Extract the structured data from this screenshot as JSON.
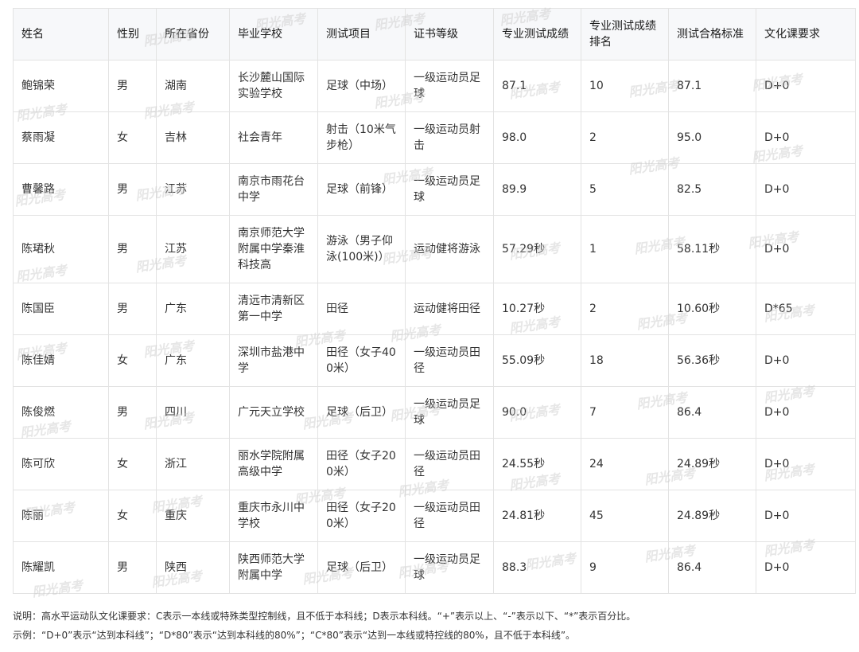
{
  "headers": [
    "姓名",
    "性别",
    "所在省份",
    "毕业学校",
    "测试项目",
    "证书等级",
    "专业测试成绩",
    "专业测试成绩排名",
    "测试合格标准",
    "文化课要求"
  ],
  "rows": [
    [
      "鲍锦荣",
      "男",
      "湖南",
      "长沙麓山国际实验学校",
      "足球（中场）",
      "一级运动员足球",
      "87.1",
      "10",
      "87.1",
      "D+0"
    ],
    [
      "蔡雨凝",
      "女",
      "吉林",
      "社会青年",
      "射击（10米气步枪）",
      "一级运动员射击",
      "98.0",
      "2",
      "95.0",
      "D+0"
    ],
    [
      "曹馨路",
      "男",
      "江苏",
      "南京市雨花台中学",
      "足球（前锋）",
      "一级运动员足球",
      "89.9",
      "5",
      "82.5",
      "D+0"
    ],
    [
      "陈珺秋",
      "男",
      "江苏",
      "南京师范大学附属中学秦淮科技高",
      "游泳（男子仰泳(100米)）",
      "运动健将游泳",
      "57.29秒",
      "1",
      "58.11秒",
      "D+0"
    ],
    [
      "陈国臣",
      "男",
      "广东",
      "清远市清新区第一中学",
      "田径",
      "运动健将田径",
      "10.27秒",
      "2",
      "10.60秒",
      "D*65"
    ],
    [
      "陈佳婧",
      "女",
      "广东",
      "深圳市盐港中学",
      "田径（女子400米）",
      "一级运动员田径",
      "55.09秒",
      "18",
      "56.36秒",
      "D+0"
    ],
    [
      "陈俊燃",
      "男",
      "四川",
      "广元天立学校",
      "足球（后卫）",
      "一级运动员足球",
      "90.0",
      "7",
      "86.4",
      "D+0"
    ],
    [
      "陈可欣",
      "女",
      "浙江",
      "丽水学院附属高级中学",
      "田径（女子200米）",
      "一级运动员田径",
      "24.55秒",
      "24",
      "24.89秒",
      "D+0"
    ],
    [
      "陈丽",
      "女",
      "重庆",
      "重庆市永川中学校",
      "田径（女子200米）",
      "一级运动员田径",
      "24.81秒",
      "45",
      "24.89秒",
      "D+0"
    ],
    [
      "陈耀凯",
      "男",
      "陕西",
      "陕西师范大学附属中学",
      "足球（后卫）",
      "一级运动员足球",
      "88.3",
      "9",
      "86.4",
      "D+0"
    ]
  ],
  "notes": {
    "line1": "说明：高水平运动队文化课要求：C表示一本线或特殊类型控制线，且不低于本科线；D表示本科线。“+”表示以上、“-”表示以下、“*”表示百分比。",
    "line2": "示例：“D+0”表示“达到本科线”；“D*80”表示“达到本科线的80%”；“C*80”表示“达到一本线或特控线的80%，且不低于本科线”。"
  },
  "watermark": "阳光高考"
}
